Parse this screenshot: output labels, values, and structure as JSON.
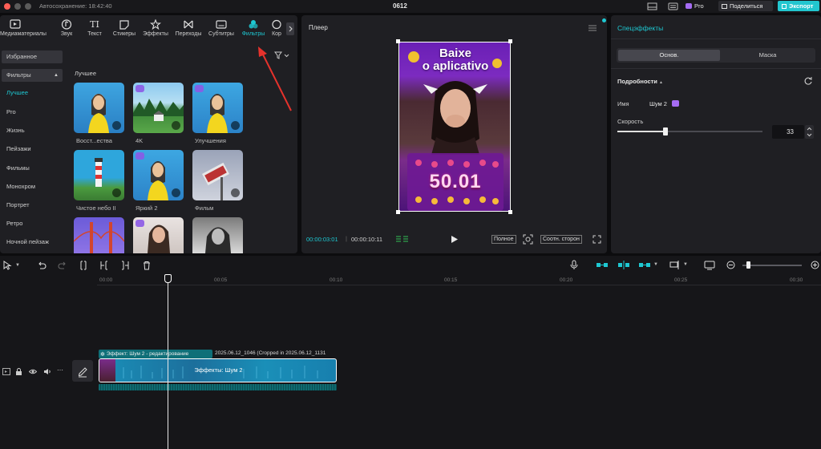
{
  "window": {
    "autosave": "Автосохранение: 18:42:40",
    "project_name": "0612",
    "pro_label": "Pro",
    "share_label": "Поделиться",
    "export_label": "Экспорт"
  },
  "toolbar": {
    "items": [
      {
        "label": "Медиаматериалы",
        "icon": "media-icon"
      },
      {
        "label": "Звук",
        "icon": "audio-icon"
      },
      {
        "label": "Текст",
        "icon": "text-icon"
      },
      {
        "label": "Стикеры",
        "icon": "sticker-icon"
      },
      {
        "label": "Эффекты",
        "icon": "effects-icon"
      },
      {
        "label": "Переходы",
        "icon": "transition-icon"
      },
      {
        "label": "Субтитры",
        "icon": "subtitles-icon"
      },
      {
        "label": "Фильтры",
        "icon": "filters-icon"
      },
      {
        "label": "Кор",
        "icon": "adjust-icon"
      }
    ]
  },
  "sidebar": {
    "favorites": "Избранное",
    "filters": "Фильтры",
    "items": [
      "Лучшее",
      "Pro",
      "Жизнь",
      "Пейзажи",
      "Фильмы",
      "Монохром",
      "Портрет",
      "Ретро",
      "Ночной пейзаж"
    ]
  },
  "gallery": {
    "section_title": "Лучшее",
    "items": [
      {
        "label": "Восст...ества"
      },
      {
        "label": "4K"
      },
      {
        "label": "Улучшения"
      },
      {
        "label": "Чистое небо II"
      },
      {
        "label": "Яркий 2"
      },
      {
        "label": "Фильм"
      },
      {
        "label": ""
      },
      {
        "label": ""
      },
      {
        "label": ""
      }
    ]
  },
  "player": {
    "title": "Плеер",
    "current_time": "00:00:03:01",
    "total_time": "00:00:10:11",
    "fullscreen_label": "Полное",
    "ratio_label": "Соотн. сторон",
    "video_text_line1": "Baixe",
    "video_text_line2": "o aplicativo",
    "video_number": "50.01"
  },
  "inspector": {
    "title": "Спецэффекты",
    "tab_basic": "Основ.",
    "tab_mask": "Маска",
    "details_label": "Подробности",
    "name_label": "Имя",
    "name_value": "Шум 2",
    "speed_label": "Скорость",
    "speed_value": "33",
    "speed_fraction": 0.33
  },
  "timeline": {
    "ruler": [
      "00:00",
      "00:05",
      "00:10",
      "00:15",
      "00:20",
      "00:25",
      "00:30"
    ],
    "effect_clip_label": "Эффект: Шум 2 - редактирование",
    "clip_name": "2025.06.12_1046 (Cropped in 2025.06.12_1131",
    "clip_effect_label": "Эффекты: Шум 2"
  },
  "colors": {
    "accent": "#1ec8d2",
    "export_bg": "#22c6cf",
    "panel": "#1f1f23",
    "clip_teal": "#0f6f78",
    "arrow": "#e6322c"
  }
}
